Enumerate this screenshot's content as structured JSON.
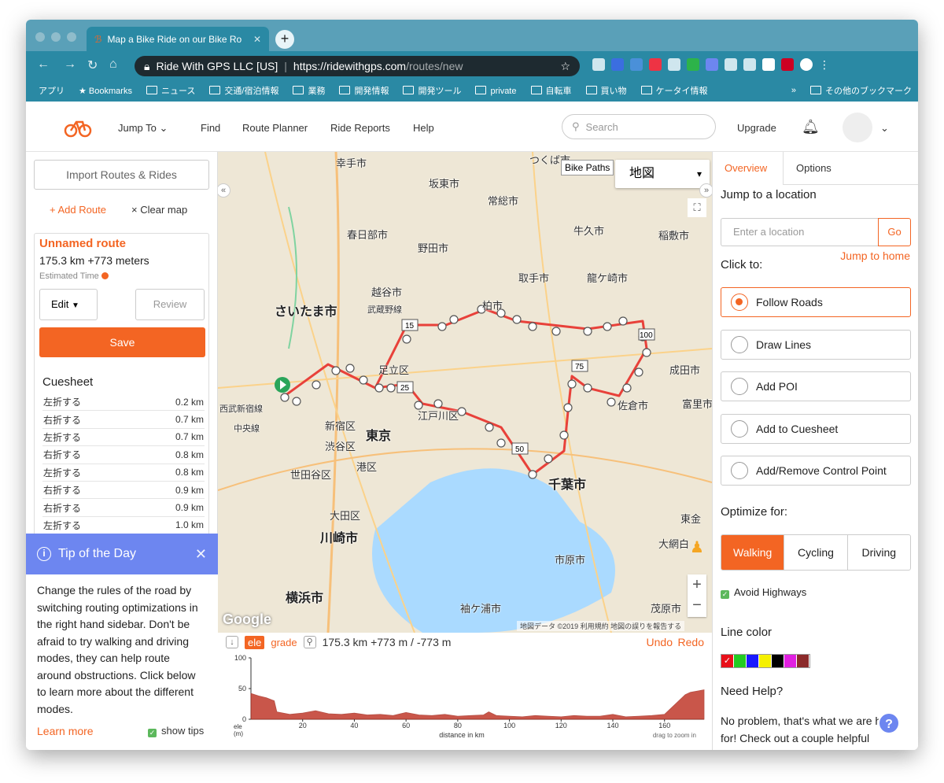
{
  "browser": {
    "tab_title": "Map a Bike Ride on our Bike Ro",
    "site_identity": "Ride With GPS LLC [US]",
    "url_host": "https://ridewithgps.com",
    "url_path": "/routes/new",
    "bookmarks": [
      "アプリ",
      "Bookmarks",
      "ニュース",
      "交通/宿泊情報",
      "業務",
      "開発情報",
      "開発ツール",
      "private",
      "自転車",
      "買い物",
      "ケータイ情報"
    ],
    "bookmarks_more": "»",
    "other_bookmarks": "その他のブックマーク"
  },
  "header": {
    "nav": [
      "Jump To",
      "Find",
      "Route Planner",
      "Ride Reports",
      "Help"
    ],
    "search_placeholder": "Search",
    "upgrade": "Upgrade"
  },
  "left": {
    "import_label": "Import Routes & Rides",
    "add_route": "+ Add Route",
    "clear_map": "× Clear map",
    "route_name": "Unnamed route",
    "route_stats": "175.3 km  +773 meters",
    "estimated_time": "Estimated Time",
    "edit_label": "Edit",
    "review_label": "Review",
    "save_label": "Save",
    "cuesheet_title": "Cuesheet",
    "cues": [
      {
        "text": "左折する",
        "dist": "0.2 km"
      },
      {
        "text": "右折する",
        "dist": "0.7 km"
      },
      {
        "text": "左折する",
        "dist": "0.7 km"
      },
      {
        "text": "右折する",
        "dist": "0.8 km"
      },
      {
        "text": "左折する",
        "dist": "0.8 km"
      },
      {
        "text": "右折する",
        "dist": "0.9 km"
      },
      {
        "text": "右折する",
        "dist": "0.9 km"
      },
      {
        "text": "左折する",
        "dist": "1.0 km"
      }
    ]
  },
  "tip": {
    "title": "Tip of the Day",
    "body": "Change the rules of the road by switching routing optimizations in the right hand sidebar. Don't be afraid to try walking and driving modes, they can help route around obstructions. Click below to learn more about the different modes.",
    "learn_more": "Learn more",
    "show_tips": "show tips"
  },
  "map": {
    "bike_paths": "Bike Paths",
    "map_type": "地図",
    "labels": [
      "幸手市",
      "坂東市",
      "つくば市",
      "常総市",
      "春日部市",
      "野田市",
      "牛久市",
      "稲敷市",
      "越谷市",
      "取手市",
      "龍ケ崎市",
      "さいたま市",
      "武蔵野線",
      "柏市",
      "足立区",
      "成田市",
      "新宿区",
      "東京",
      "江戸川区",
      "渋谷区",
      "港区",
      "世田谷区",
      "千葉市",
      "大田区",
      "川崎市",
      "横浜市",
      "市原市",
      "袖ケ浦市",
      "茂原市",
      "大網白",
      "中央線",
      "西武新宿線",
      "東金",
      "富里市",
      "佐倉市"
    ],
    "google": "Google",
    "footer": "地図データ ©2019   利用規約   地図の誤りを報告する"
  },
  "elevation": {
    "ele": "ele",
    "grade": "grade",
    "summary": "175.3 km +773 m / -773 m",
    "undo": "Undo",
    "redo": "Redo",
    "y_ticks": [
      "100",
      "50",
      "0"
    ],
    "x_ticks": [
      "20",
      "40",
      "60",
      "80",
      "100",
      "120",
      "140",
      "160"
    ],
    "y_unit": "ele\n(m)",
    "x_label": "distance in km",
    "hint": "drag to zoom in"
  },
  "chart_data": {
    "type": "area",
    "xlabel": "distance in km",
    "ylabel": "ele (m)",
    "xlim": [
      0,
      175.3
    ],
    "ylim": [
      0,
      100
    ],
    "x": [
      0,
      3,
      6,
      9,
      10,
      15,
      20,
      25,
      30,
      35,
      40,
      45,
      50,
      55,
      60,
      65,
      70,
      75,
      80,
      85,
      90,
      92,
      95,
      100,
      105,
      110,
      115,
      120,
      125,
      130,
      135,
      140,
      145,
      150,
      155,
      160,
      165,
      168,
      170,
      175.3
    ],
    "y": [
      42,
      38,
      35,
      30,
      12,
      8,
      10,
      14,
      9,
      8,
      10,
      7,
      8,
      6,
      11,
      7,
      6,
      8,
      5,
      6,
      7,
      12,
      6,
      5,
      4,
      6,
      5,
      4,
      6,
      5,
      5,
      8,
      4,
      5,
      6,
      8,
      28,
      40,
      44,
      48
    ],
    "colors": {
      "fill": "#c0392b",
      "stroke": "#a93226"
    }
  },
  "right": {
    "tab_overview": "Overview",
    "tab_options": "Options",
    "jump_to_location": "Jump to a location",
    "location_placeholder": "Enter a location",
    "go": "Go",
    "jump_home": "Jump to home",
    "click_to": "Click to:",
    "modes": [
      "Follow Roads",
      "Draw Lines",
      "Add POI",
      "Add to Cuesheet",
      "Add/Remove Control Point"
    ],
    "optimize_for": "Optimize for:",
    "optimize": [
      "Walking",
      "Cycling",
      "Driving"
    ],
    "avoid_highways": "Avoid Highways",
    "line_color": "Line color",
    "colors": [
      "#e8101a",
      "#22cc22",
      "#1a1aff",
      "#f5f000",
      "#000000",
      "#e020e0",
      "#8b2a2a"
    ],
    "need_help": "Need Help?",
    "help_text": "No problem, that's what we are here for! Check out a couple helpful"
  }
}
